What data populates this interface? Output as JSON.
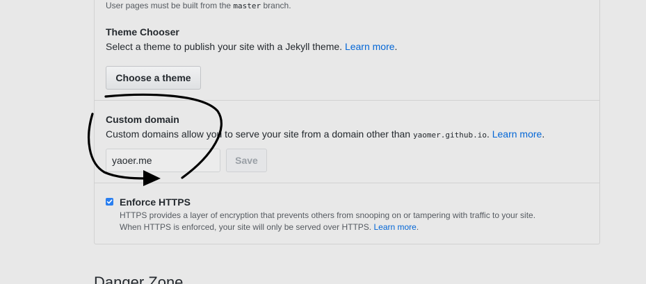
{
  "pages_branch_note": {
    "prefix": "User pages must be built from the ",
    "branch": "master",
    "suffix": " branch."
  },
  "theme_chooser": {
    "title": "Theme Chooser",
    "description": "Select a theme to publish your site with a Jekyll theme.",
    "learn_more": "Learn more",
    "period": ".",
    "button_label": "Choose a theme"
  },
  "custom_domain": {
    "title": "Custom domain",
    "description_prefix": "Custom domains allow you to serve your site from a domain other than ",
    "default_domain": "yaomer.github.io",
    "description_suffix": ".",
    "learn_more": "Learn more",
    "period": ".",
    "input_value": "yaoer.me",
    "save_label": "Save"
  },
  "enforce_https": {
    "label": "Enforce HTTPS",
    "checked": true,
    "line1": "HTTPS provides a layer of encryption that prevents others from snooping on or tampering with traffic to your site.",
    "line2_prefix": "When HTTPS is enforced, your site will only be served over HTTPS. ",
    "learn_more": "Learn more",
    "period": "."
  },
  "next_section": {
    "title": "Danger Zone"
  },
  "colors": {
    "link": "#0366d6",
    "checkbox": "#2a7ff0",
    "annotation": "#000000"
  }
}
